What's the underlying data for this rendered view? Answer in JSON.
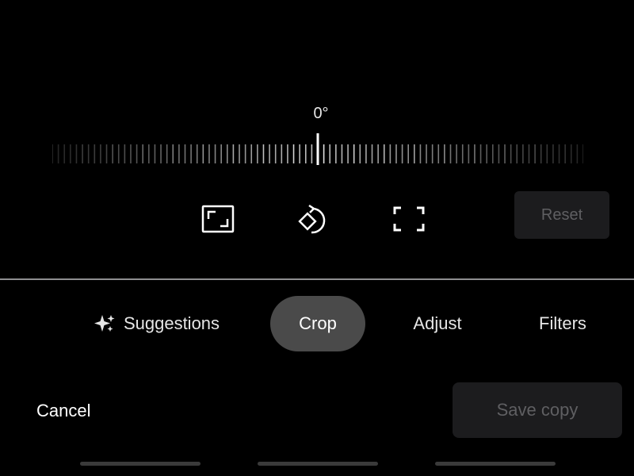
{
  "rotation": {
    "angle_label": "0°",
    "angle_value": 0
  },
  "tools": {
    "aspect_icon": "aspect-ratio-icon",
    "rotate_icon": "rotate-icon",
    "free_crop_icon": "free-crop-icon",
    "reset_label": "Reset"
  },
  "tabs": [
    {
      "label": "Suggestions",
      "icon": "sparkle-icon",
      "active": false
    },
    {
      "label": "Crop",
      "active": true
    },
    {
      "label": "Adjust",
      "active": false
    },
    {
      "label": "Filters",
      "active": false
    }
  ],
  "footer": {
    "cancel_label": "Cancel",
    "save_label": "Save copy"
  },
  "colors": {
    "background": "#000000",
    "active_tab": "#4a4a4a",
    "disabled_button_bg": "#1c1c1e",
    "disabled_text": "#5f5f62",
    "divider": "#8e8e90"
  }
}
